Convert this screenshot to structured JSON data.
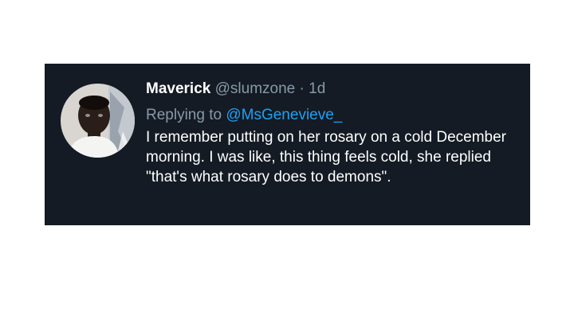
{
  "tweet": {
    "display_name": "Maverick",
    "handle": "@slumzone",
    "separator": "·",
    "timestamp": "1d",
    "replying_prefix": "Replying to",
    "replying_to": "@MsGenevieve_",
    "text": "I remember putting on her rosary on a cold December morning. I was like, this thing feels cold, she replied \"that's what rosary does to demons\"."
  },
  "colors": {
    "card_background": "#141b24",
    "muted_text": "#8899a6",
    "mention_link": "#1da1f2",
    "primary_text": "#ffffff"
  }
}
